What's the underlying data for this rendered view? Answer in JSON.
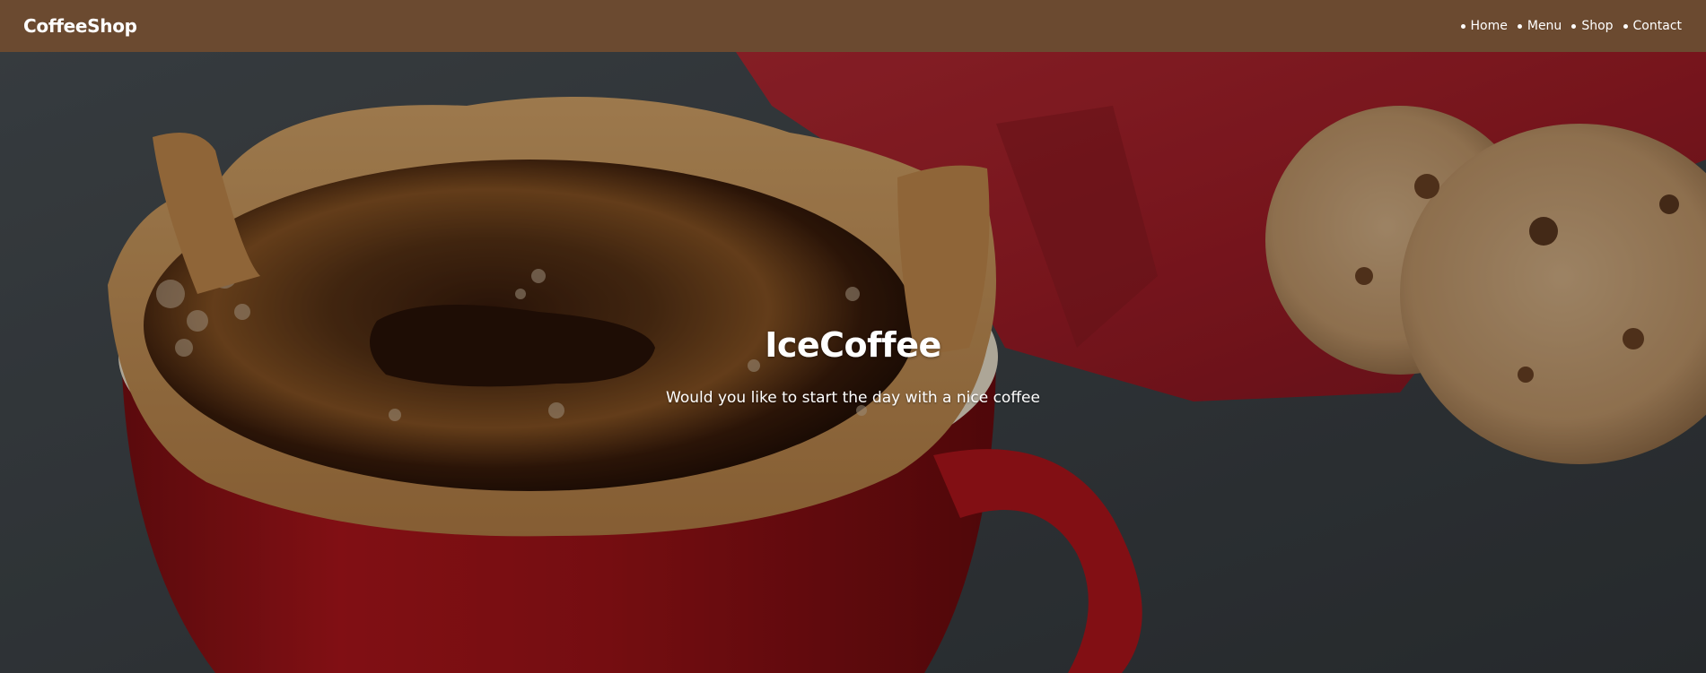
{
  "navbar": {
    "brand": "CoffeeShop",
    "background": "#6b4a30",
    "items": [
      {
        "label": "Home"
      },
      {
        "label": "Menu"
      },
      {
        "label": "Shop"
      },
      {
        "label": "Contact"
      }
    ]
  },
  "hero": {
    "title": "IceCoffee",
    "subtitle": "Would you like to start the day with a nice coffee",
    "image_subject": "coffee in red cup with paper filter, red napkin and cookies"
  }
}
